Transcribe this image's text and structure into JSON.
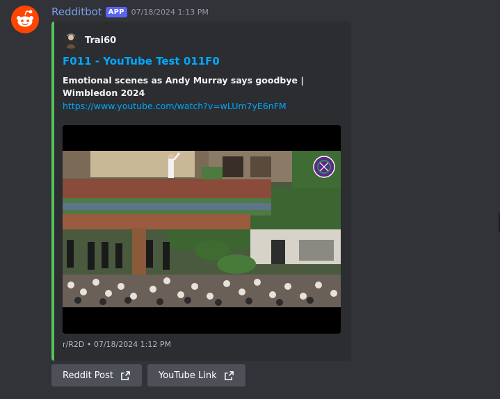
{
  "message": {
    "username": "Redditbot",
    "badge": "APP",
    "timestamp": "07/18/2024 1:13 PM",
    "avatar_icon": "reddit-snoo-icon"
  },
  "embed": {
    "accent_color": "#57c25a",
    "author_name": "Trai60",
    "author_icon": "user-avatar-icon",
    "title": "F011 - YouTube Test 011F0",
    "description_bold": "Emotional scenes as Andy Murray says goodbye | Wimbledon 2024",
    "description_link": "https://www.youtube.com/watch?v=wLUm7yE6nFM",
    "image_icon": "wimbledon-crowd-photo",
    "footer": "r/R2D • 07/18/2024 1:12 PM"
  },
  "buttons": [
    {
      "label": "Reddit Post",
      "icon": "external-link-icon"
    },
    {
      "label": "YouTube Link",
      "icon": "external-link-icon"
    }
  ],
  "colors": {
    "background": "#313338",
    "embed_background": "#2b2d31",
    "link": "#00a8fc",
    "username": "#7a9fe6",
    "badge": "#5865f2",
    "button": "#4e5058"
  }
}
